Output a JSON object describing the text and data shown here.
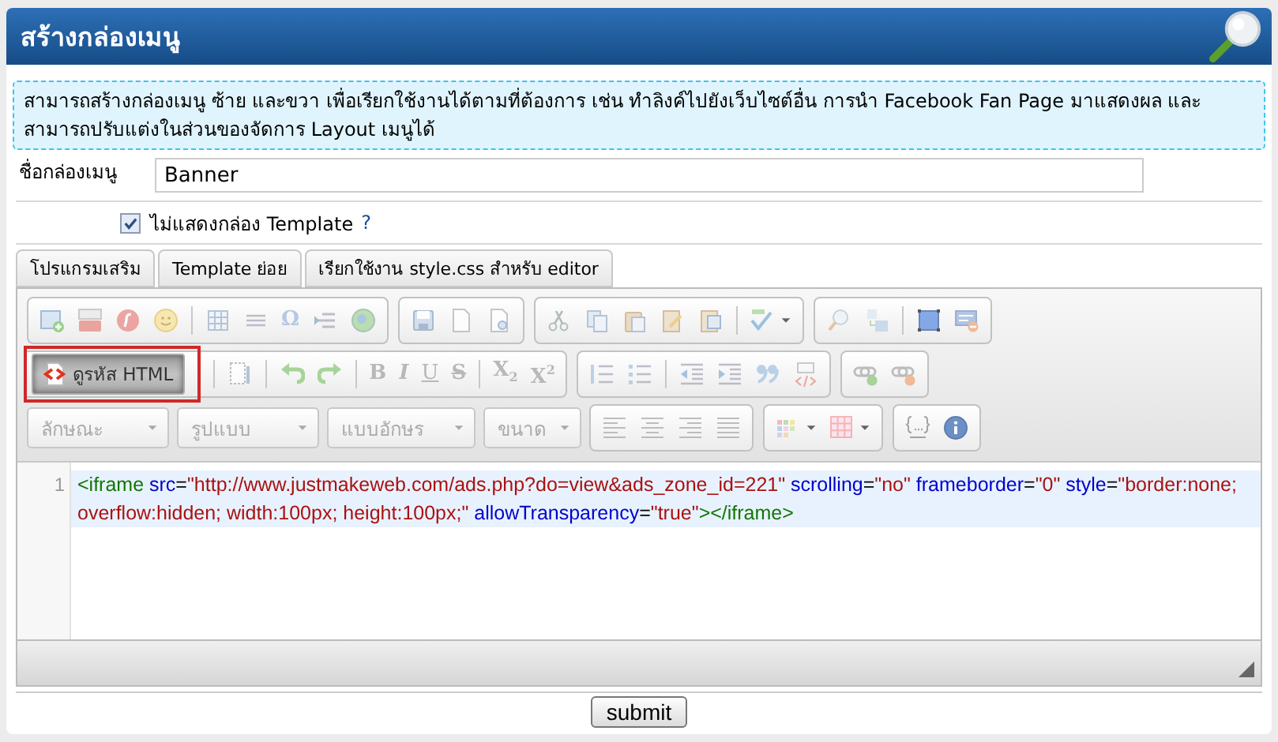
{
  "header": {
    "title": "สร้างกล่องเมนู"
  },
  "notice": "สามารถสร้างกล่องเมนู ซ้าย และขวา เพื่อเรียกใช้งานได้ตามที่ต้องการ เช่น ทำลิงค์ไปยังเว็บไซต์อื่น การนำ Facebook Fan Page มาแสดงผล และสามารถปรับแต่งในส่วนของจัดการ Layout เมนูได้",
  "form": {
    "name_label": "ชื่อกล่องเมนู",
    "name_value": "Banner",
    "hide_template": {
      "label": "ไม่แสดงกล่อง Template",
      "checked": true,
      "help": "?"
    }
  },
  "tabs": [
    {
      "label": "โปรแกรมเสริม"
    },
    {
      "label": "Template ย่อย"
    },
    {
      "label": "เรียกใช้งาน style.css สำหรับ editor"
    }
  ],
  "editor": {
    "source_button": {
      "label": "ดูรหัส HTML",
      "selected": true,
      "highlighted": true
    },
    "glyph_buttons": [
      {
        "kind": "symbol",
        "label": "Ω"
      },
      {
        "kind": "bold",
        "label": "B"
      },
      {
        "kind": "italic",
        "label": "I"
      },
      {
        "kind": "underline",
        "label": "U"
      },
      {
        "kind": "strike",
        "label": "S"
      },
      {
        "kind": "subscript",
        "label": "X$_{2}$"
      },
      {
        "kind": "superscript",
        "label": "X$^{2}$"
      }
    ],
    "combos": [
      {
        "label": "ลักษณะ"
      },
      {
        "label": "รูปแบบ"
      },
      {
        "label": "แบบอักษร"
      },
      {
        "label": "ขนาด"
      }
    ],
    "code": {
      "line_number": "1",
      "tokens": [
        {
          "kind": "tag",
          "text": "<iframe"
        },
        {
          "kind": "attr",
          "text": " src"
        },
        {
          "kind": "punct",
          "text": "="
        },
        {
          "kind": "value",
          "text": "\"http://www.justmakeweb.com/ads.php?do=view&ads_zone_id=221\""
        },
        {
          "kind": "attr",
          "text": " scrolling"
        },
        {
          "kind": "punct",
          "text": "="
        },
        {
          "kind": "value",
          "text": "\"no\""
        },
        {
          "kind": "attr",
          "text": " frameborder"
        },
        {
          "kind": "punct",
          "text": "="
        },
        {
          "kind": "value",
          "text": "\"0\""
        },
        {
          "kind": "attr",
          "text": " style"
        },
        {
          "kind": "punct",
          "text": "="
        },
        {
          "kind": "value",
          "text": "\"border:none; overflow:hidden; width:100px; height:100px;\""
        },
        {
          "kind": "attr",
          "text": " allowTransparency"
        },
        {
          "kind": "punct",
          "text": "="
        },
        {
          "kind": "value",
          "text": "\"true\""
        },
        {
          "kind": "tag",
          "text": "></iframe>"
        }
      ]
    }
  },
  "submit": "submit"
}
